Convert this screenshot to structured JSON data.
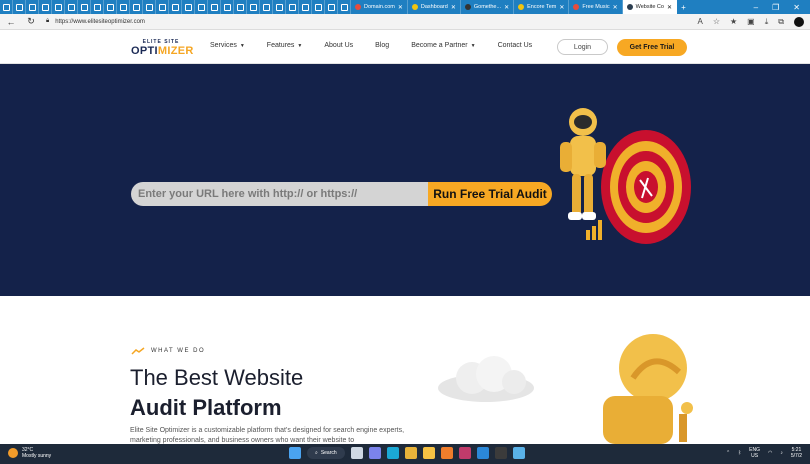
{
  "browser": {
    "tabs": [
      {
        "label": "Domain.com",
        "color": "#e74c3c"
      },
      {
        "label": "Dashboard",
        "color": "#f1c40f"
      },
      {
        "label": "Gomethe...",
        "color": "#333333"
      },
      {
        "label": "Encore Tem",
        "color": "#f1c40f"
      },
      {
        "label": "Free Music",
        "color": "#e74c3c"
      },
      {
        "label": "Website Co",
        "color": "#2c3e50"
      }
    ],
    "url": "https://www.elitesiteoptimizer.com",
    "icons": {
      "back": "back-arrow-icon",
      "refresh": "refresh-icon",
      "lock": "lock-icon",
      "new_tab": "plus-icon"
    }
  },
  "header": {
    "logo_top": "ELITE SITE",
    "logo_main_a": "OPTI",
    "logo_main_b": "MIZER",
    "nav": [
      {
        "label": "Services",
        "has_dropdown": true
      },
      {
        "label": "Features",
        "has_dropdown": true
      },
      {
        "label": "About Us",
        "has_dropdown": false
      },
      {
        "label": "Blog",
        "has_dropdown": false
      },
      {
        "label": "Become a Partner",
        "has_dropdown": true
      },
      {
        "label": "Contact Us",
        "has_dropdown": false
      }
    ],
    "login": "Login",
    "cta": "Get Free Trial"
  },
  "hero": {
    "url_placeholder": "Enter your URL here with http:// or https://",
    "audit_button": "Run Free Trial Audit"
  },
  "section": {
    "kicker": "WHAT WE DO",
    "heading_light": "The Best Website",
    "heading_bold": "Audit Platform",
    "paragraph": "Elite Site Optimizer is a customizable platform that's designed for search engine experts, marketing professionals, and business owners who want their website to"
  },
  "taskbar": {
    "weather_temp": "32°C",
    "weather_desc": "Mostly sunny",
    "search": "Search",
    "lang": "ENG",
    "region": "US",
    "time": "5:21",
    "date": "5/7/2"
  },
  "colors": {
    "brand_navy": "#14224a",
    "accent": "#f7a823"
  }
}
